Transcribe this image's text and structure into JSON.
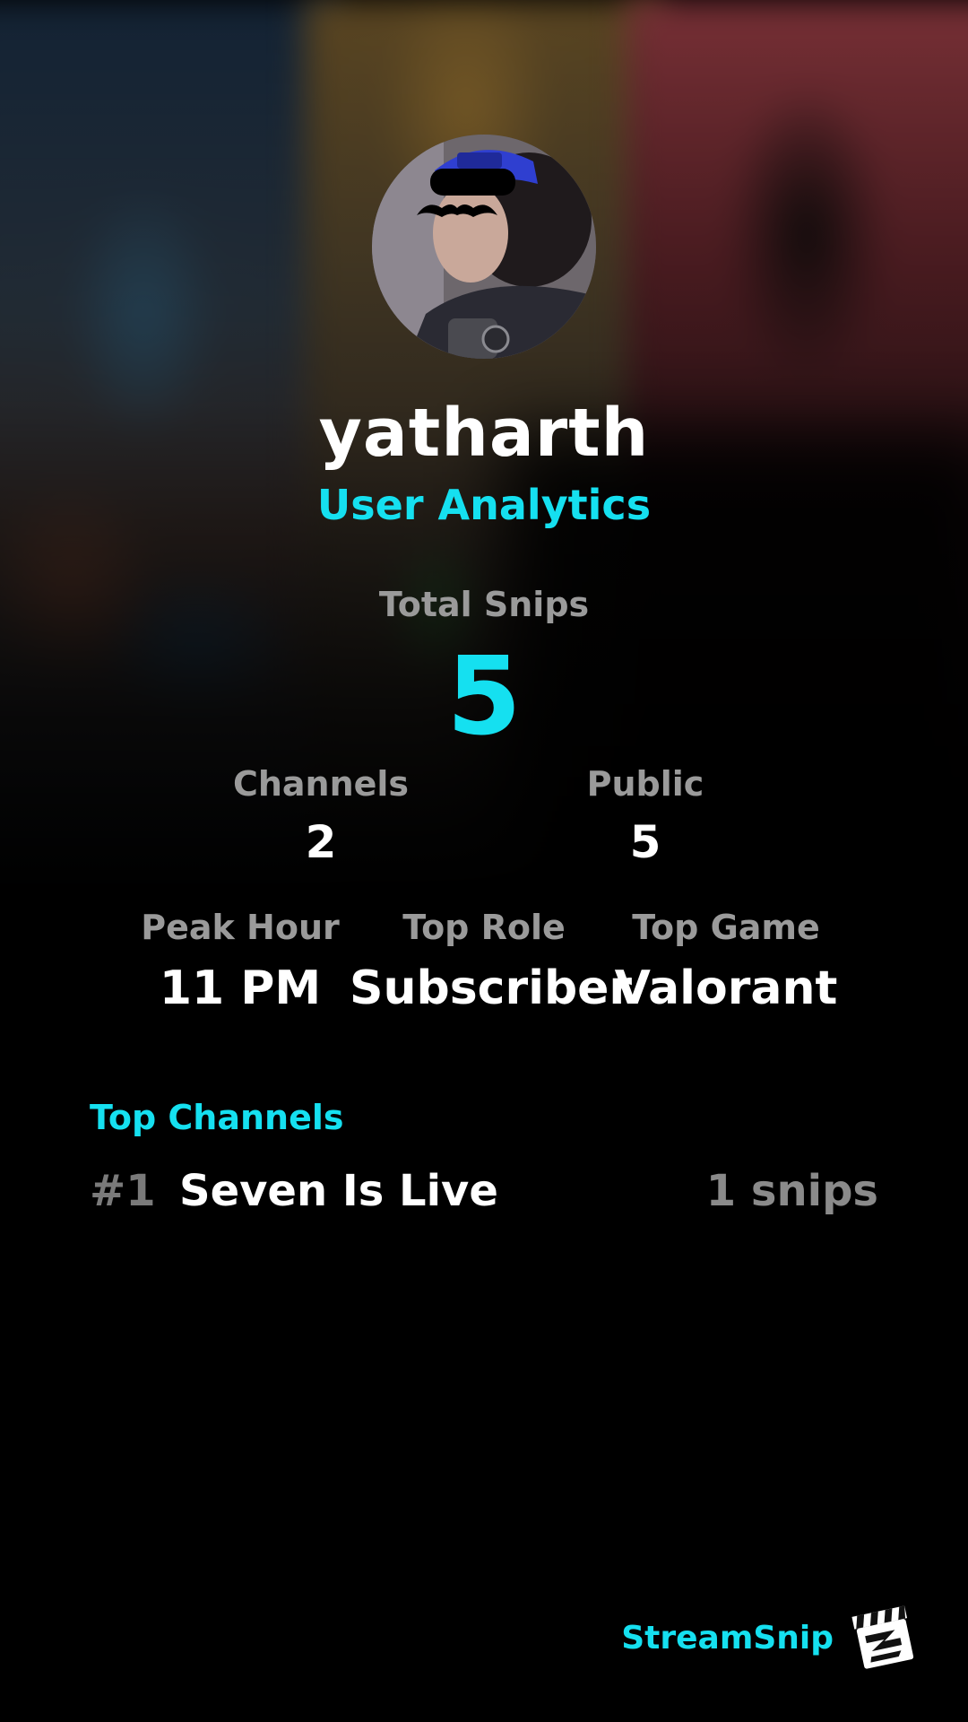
{
  "profile": {
    "username": "yatharth",
    "subtitle": "User Analytics"
  },
  "stats": {
    "total_label": "Total Snips",
    "total_value": "5",
    "channels_label": "Channels",
    "channels_value": "2",
    "public_label": "Public",
    "public_value": "5",
    "peak_label": "Peak Hour",
    "peak_value": "11 PM",
    "role_label": "Top Role",
    "role_value": "Subscriber",
    "game_label": "Top Game",
    "game_value": "Valorant"
  },
  "top_channels": {
    "title": "Top Channels",
    "items": [
      {
        "rank": "#1",
        "name": "Seven Is Live",
        "count": "1 snips"
      }
    ]
  },
  "brand": {
    "name": "StreamSnip",
    "logo_icon": "clapperboard-icon"
  },
  "colors": {
    "accent": "#15e0f0",
    "background": "#000000",
    "muted": "#9a9a9a"
  }
}
